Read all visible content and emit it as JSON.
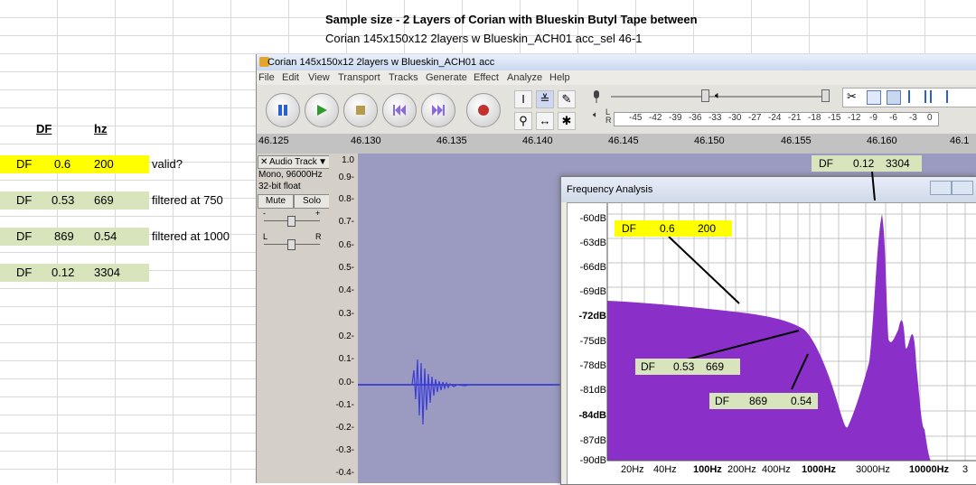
{
  "header": {
    "title": "Sample size - 2 Layers of Corian with Blueskin Butyl Tape between",
    "subtitle": "Corian 145x150x12 2layers w Blueskin_ACH01 acc_sel 46-1"
  },
  "table": {
    "col_df": "DF",
    "col_hz": "hz",
    "rows": [
      {
        "label": "DF",
        "a": "0.6",
        "b": "200",
        "note": "valid?"
      },
      {
        "label": "DF",
        "a": "0.53",
        "b": "669",
        "note": "filtered at 750"
      },
      {
        "label": "DF",
        "a": "869",
        "b": "0.54",
        "note": "filtered at 1000"
      },
      {
        "label": "DF",
        "a": "0.12",
        "b": "3304",
        "note": ""
      }
    ]
  },
  "audacity": {
    "title": "Corian 145x150x12 2layers w Blueskin_ACH01 acc",
    "menu": [
      "File",
      "Edit",
      "View",
      "Transport",
      "Tracks",
      "Generate",
      "Effect",
      "Analyze",
      "Help"
    ],
    "meter_label_l": "L",
    "meter_label_r": "R",
    "meter_ticks": [
      "-45",
      "-42",
      "-39",
      "-36",
      "-33",
      "-30",
      "-27",
      "-24",
      "-21",
      "-18",
      "-15",
      "-12",
      "-9",
      "-6",
      "-3",
      "0"
    ],
    "ruler": [
      "46.125",
      "46.130",
      "46.135",
      "46.140",
      "46.145",
      "46.150",
      "46.155",
      "46.160",
      "46.1"
    ],
    "track": {
      "name": "Audio Track",
      "info1": "Mono, 96000Hz",
      "info2": "32-bit float",
      "mute": "Mute",
      "solo": "Solo",
      "gain_min": "-",
      "gain_max": "+",
      "pan_l": "L",
      "pan_r": "R"
    },
    "amp_scale": [
      "1.0",
      "0.9-",
      "0.8-",
      "0.7-",
      "0.6-",
      "0.5-",
      "0.4-",
      "0.3-",
      "0.2-",
      "0.1-",
      "0.0-",
      "-0.1-",
      "-0.2-",
      "-0.3-",
      "-0.4-"
    ]
  },
  "freq_analysis": {
    "title": "Frequency Analysis",
    "y_ticks": [
      "-60dB",
      "-63dB",
      "-66dB",
      "-69dB",
      "-72dB",
      "-75dB",
      "-78dB",
      "-81dB",
      "-84dB",
      "-87dB",
      "-90dB"
    ],
    "x_ticks": [
      "20Hz",
      "40Hz",
      "100Hz",
      "200Hz",
      "400Hz",
      "1000Hz",
      "3000Hz",
      "10000Hz",
      "3"
    ],
    "fill_color": "#8a2fc8"
  },
  "callouts": [
    {
      "label": "DF",
      "a": "0.12",
      "b": "3304"
    },
    {
      "label": "DF",
      "a": "0.6",
      "b": "200"
    },
    {
      "label": "DF",
      "a": "0.53",
      "b": "669"
    },
    {
      "label": "DF",
      "a": "869",
      "b": "0.54"
    }
  ]
}
